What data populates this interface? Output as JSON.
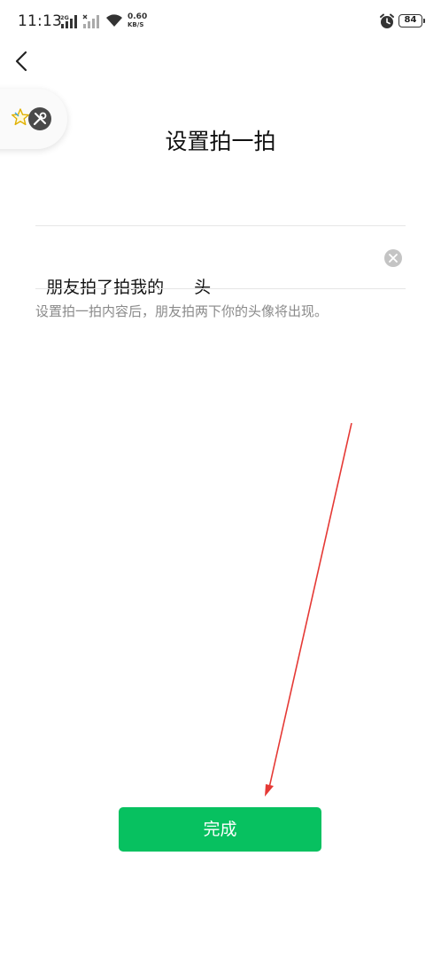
{
  "status_bar": {
    "time": "11:13",
    "net_type": "2G",
    "net_speed_value": "0.60",
    "net_speed_unit": "KB/S",
    "battery": "84"
  },
  "page": {
    "title": "设置拍一拍",
    "pat_prefix": "朋友拍了拍我的",
    "pat_suffix": "头",
    "hint": "设置拍一拍内容后，朋友拍两下你的头像将出现。",
    "done_label": "完成"
  },
  "colors": {
    "accent": "#07c160",
    "annotation_arrow": "#e53935"
  }
}
